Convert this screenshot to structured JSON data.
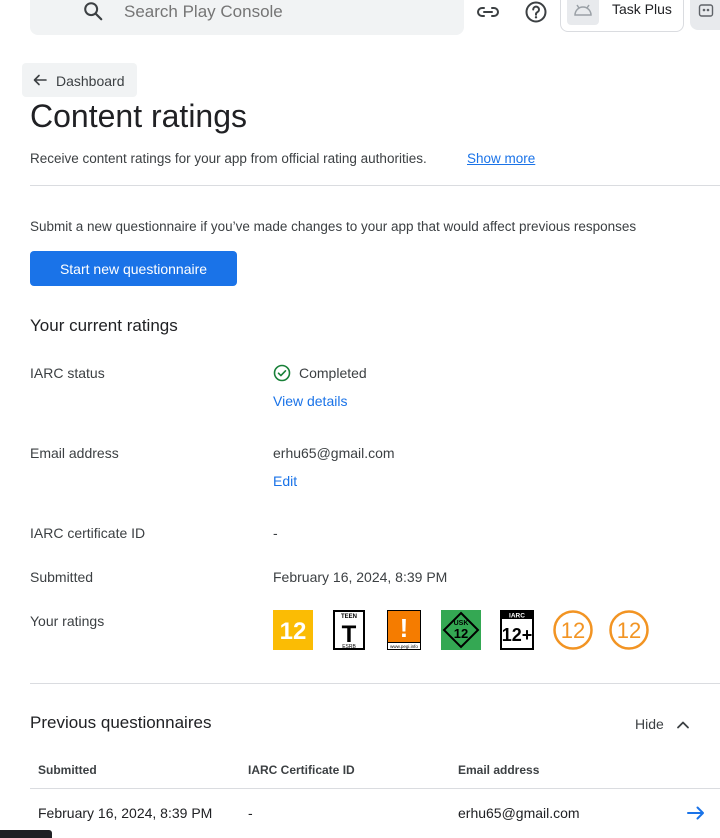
{
  "search": {
    "placeholder": "Search Play Console"
  },
  "app": {
    "name": "Task Plus"
  },
  "nav": {
    "back_label": "Dashboard"
  },
  "page": {
    "title": "Content ratings",
    "subtitle": "Receive content ratings for your app from official rating authorities.",
    "show_more": "Show more"
  },
  "questionnaire": {
    "note": "Submit a new questionnaire if you’ve made changes to your app that would affect previous responses",
    "start_button": "Start new questionnaire"
  },
  "current": {
    "heading": "Your current ratings",
    "iarc_status_label": "IARC status",
    "iarc_status_value": "Completed",
    "view_details": "View details",
    "email_label": "Email address",
    "email_value": "erhu65@gmail.com",
    "edit": "Edit",
    "cert_label": "IARC certificate ID",
    "cert_value": "-",
    "submitted_label": "Submitted",
    "submitted_value": "February 16, 2024, 8:39 PM",
    "ratings_label": "Your ratings",
    "ratings": [
      {
        "icon": "classind-12-badge",
        "text": "12",
        "color": "#fbbc04"
      },
      {
        "icon": "esrb-teen-badge",
        "text": "T",
        "top": "TEEN",
        "bottom": "ESRB"
      },
      {
        "icon": "pegi-parental-guidance-badge",
        "text": "!",
        "footer": "www.pegi.info",
        "color": "#f57c00"
      },
      {
        "icon": "usk-12-badge",
        "top": "USK",
        "text": "12",
        "bottom": "ab",
        "color": "#34a853"
      },
      {
        "icon": "iarc-12-badge",
        "top": "IARC",
        "text": "12+"
      },
      {
        "icon": "generic-12-circle-badge",
        "text": "12",
        "color": "#f29423"
      },
      {
        "icon": "generic-12-circle-badge-2",
        "text": "12",
        "color": "#f29423"
      }
    ]
  },
  "previous": {
    "heading": "Previous questionnaires",
    "hide": "Hide",
    "columns": [
      "Submitted",
      "IARC Certificate ID",
      "Email address"
    ],
    "rows": [
      {
        "submitted": "February 16, 2024, 8:39 PM",
        "cert": "-",
        "email": "erhu65@gmail.com"
      }
    ]
  }
}
